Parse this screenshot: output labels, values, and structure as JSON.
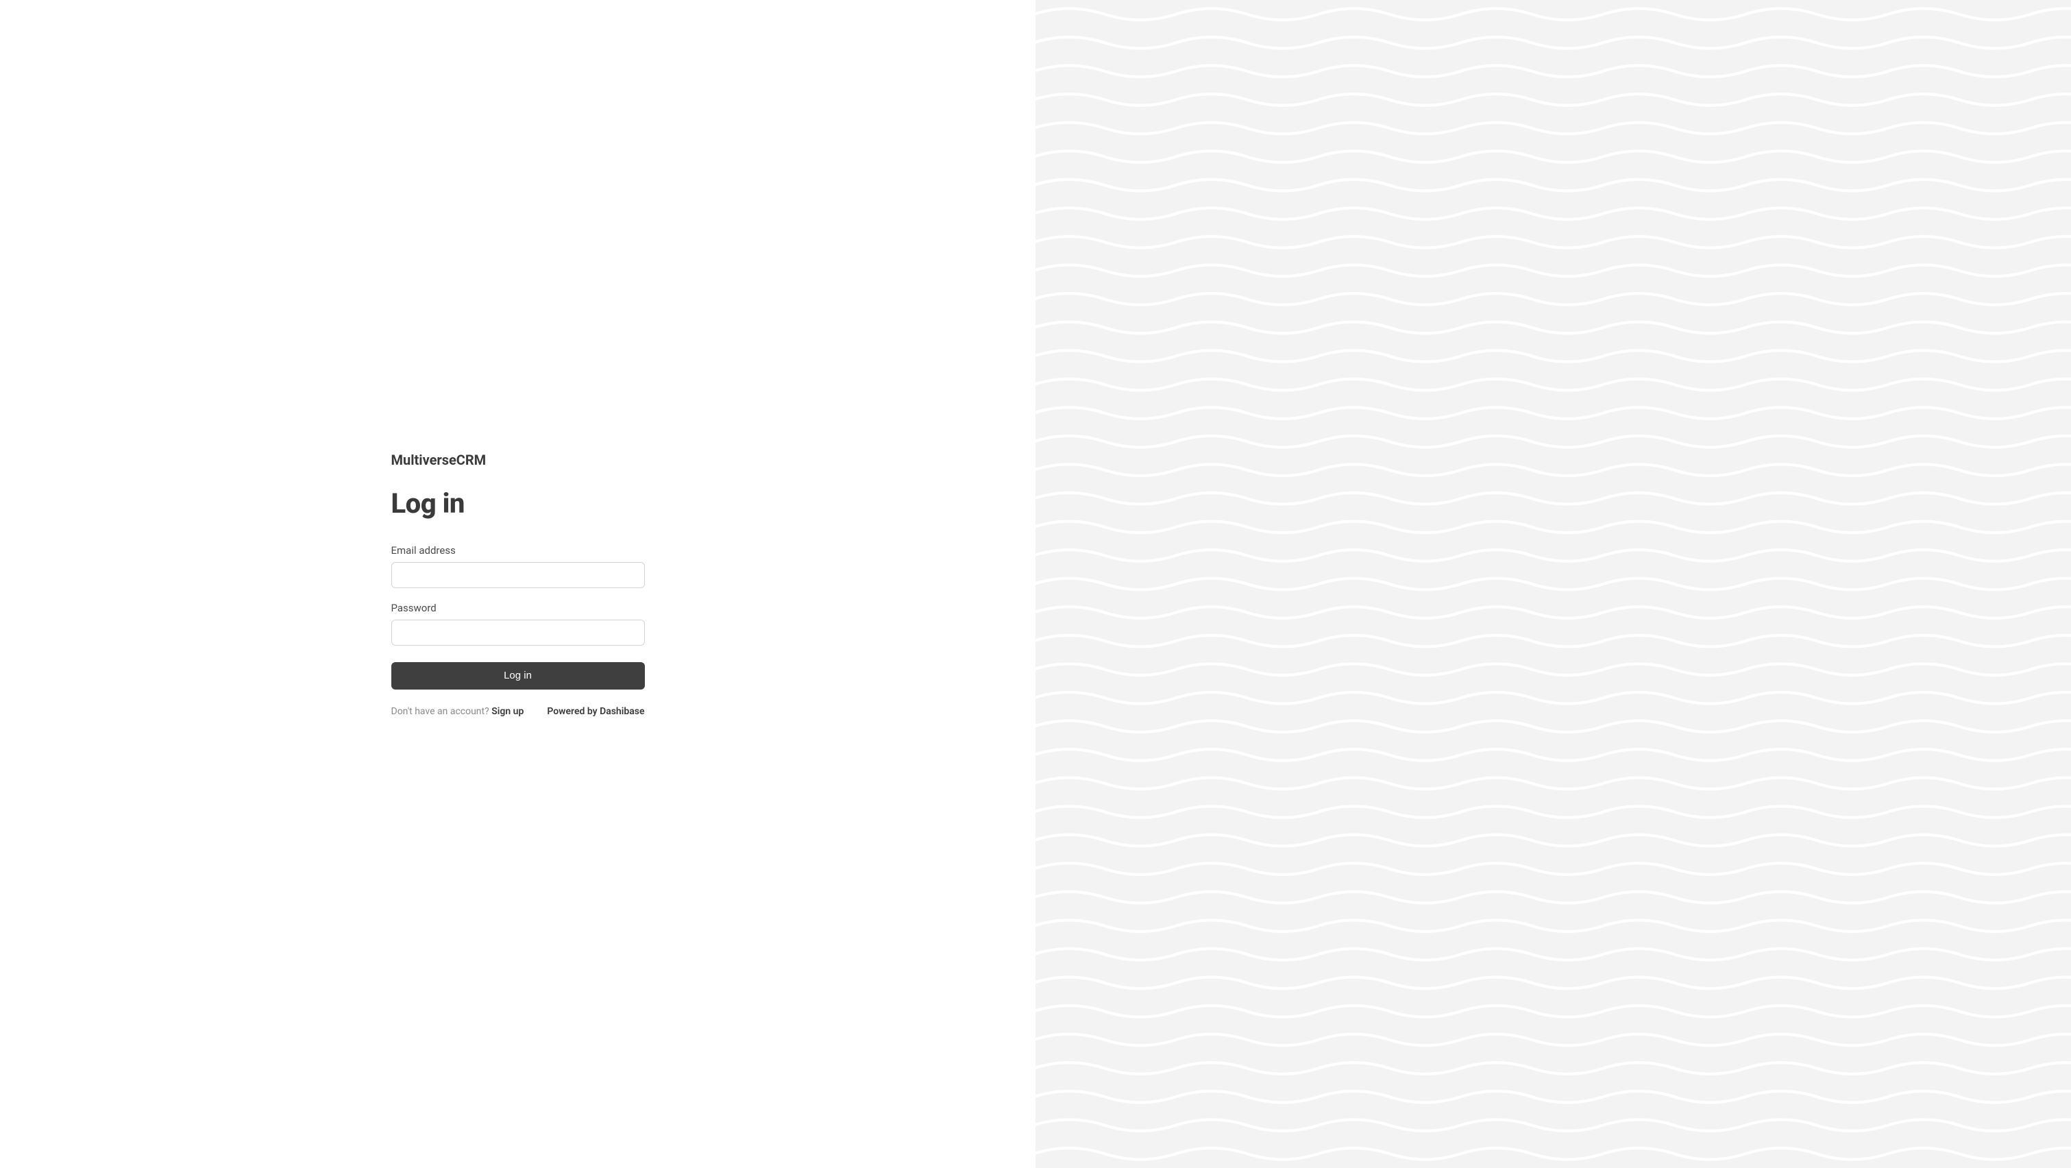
{
  "brand": "MultiverseCRM",
  "title": "Log in",
  "form": {
    "email_label": "Email address",
    "email_value": "",
    "password_label": "Password",
    "password_value": "",
    "submit_label": "Log in"
  },
  "footer": {
    "signup_prompt": "Don't have an account? ",
    "signup_link": "Sign up",
    "powered_by": "Powered by Dashibase"
  },
  "colors": {
    "text_primary": "#3a3a3a",
    "text_secondary": "#8a8a8a",
    "button_bg": "#3f3f3f",
    "input_border": "#d1d5db",
    "right_bg": "#f5f5f5"
  }
}
